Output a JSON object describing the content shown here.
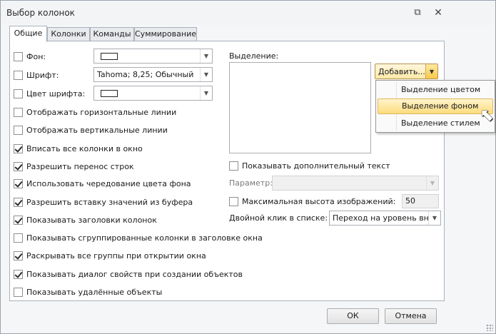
{
  "window": {
    "title": "Выбор колонок",
    "restore_icon": "restore-icon",
    "close_icon": "close-icon"
  },
  "tabs": [
    "Общие",
    "Колонки",
    "Команды",
    "Суммирование"
  ],
  "active_tab": 0,
  "general": {
    "background": {
      "label": "Фон:",
      "checked": false,
      "swatch_color": "#ffffff"
    },
    "font": {
      "label": "Шрифт:",
      "checked": false,
      "value": "Tahoma; 8,25; Обычный"
    },
    "font_color": {
      "label": "Цвет шрифта:",
      "checked": false,
      "swatch_color": "#ffffff"
    },
    "options": [
      {
        "label": "Отображать горизонтальные линии",
        "checked": false
      },
      {
        "label": "Отображать вертикальные линии",
        "checked": false
      },
      {
        "label": "Вписать все колонки в окно",
        "checked": true
      },
      {
        "label": "Разрешить перенос строк",
        "checked": true
      },
      {
        "label": "Использовать чередование цвета фона",
        "checked": true
      },
      {
        "label": "Разрешить вставку значений из буфера",
        "checked": true
      },
      {
        "label": "Показывать заголовки колонок",
        "checked": true
      },
      {
        "label": "Показывать сгруппированные колонки в заголовке окна",
        "checked": false
      },
      {
        "label": "Раскрывать все группы при открытии окна",
        "checked": true
      },
      {
        "label": "Показывать диалог свойств при создании объектов",
        "checked": true
      },
      {
        "label": "Показывать удалённые объекты",
        "checked": false
      }
    ],
    "selection": {
      "label": "Выделение:",
      "add_button": "Добавить...",
      "menu": [
        "Выделение цветом",
        "Выделение фоном",
        "Выделение стилем"
      ],
      "hovered_index": 1
    },
    "show_extra_text": {
      "label": "Показывать дополнительный текст",
      "checked": false
    },
    "parameter": {
      "label": "Параметр:",
      "value": ""
    },
    "max_image_height": {
      "label": "Максимальная высота изображений:",
      "checked": false,
      "value": "50"
    },
    "double_click": {
      "label": "Двойной клик в списке:",
      "value": "Переход на уровень вниз"
    }
  },
  "buttons": {
    "ok": "ОК",
    "cancel": "Отмена"
  },
  "colors": {
    "accent_hover": "#fddc7d",
    "panel_border": "#a9b1bb"
  }
}
